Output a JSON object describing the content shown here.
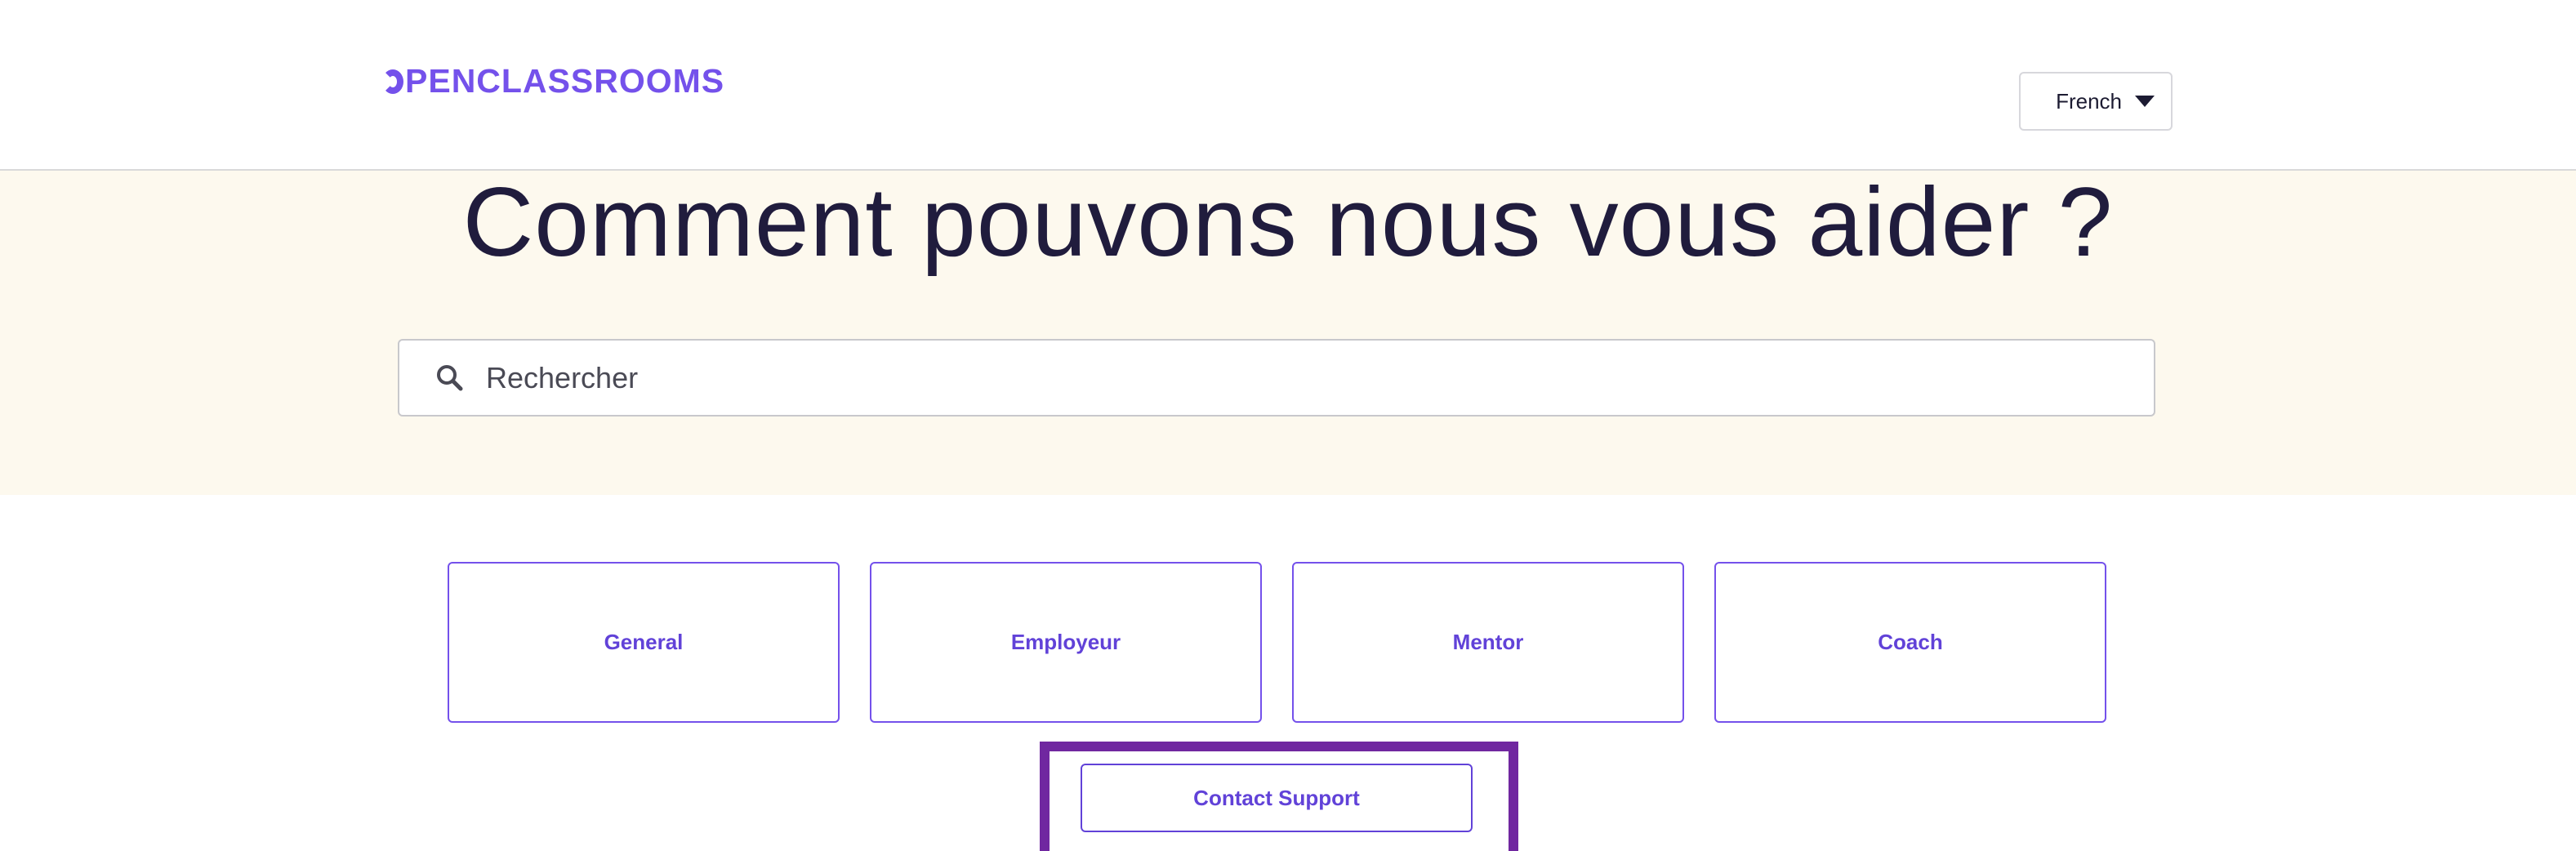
{
  "header": {
    "logo_text": "PENCLASSROOMS",
    "language_select": {
      "selected": "French",
      "icon": "caret-down-icon"
    }
  },
  "hero": {
    "title": "Comment pouvons nous vous aider ?",
    "search": {
      "placeholder": "Rechercher",
      "value": "",
      "icon": "search-icon"
    }
  },
  "categories": [
    {
      "label": "General"
    },
    {
      "label": "Employeur"
    },
    {
      "label": "Mentor"
    },
    {
      "label": "Coach"
    }
  ],
  "contact": {
    "label": "Contact Support"
  },
  "colors": {
    "brand": "#7451eb",
    "accent_text": "#6142d8",
    "title_text": "#201c3d",
    "hero_background": "#fdf9ee",
    "highlight_frame": "#7027a0"
  }
}
